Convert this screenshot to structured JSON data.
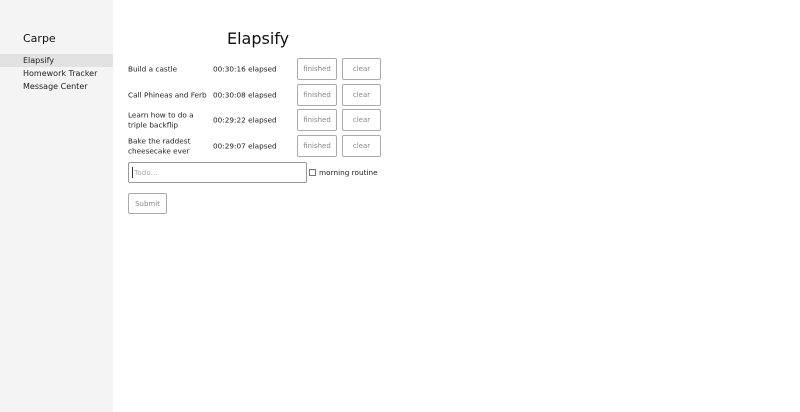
{
  "sidebar": {
    "brand": "Carpe",
    "items": [
      {
        "label": "Elapsify",
        "active": true
      },
      {
        "label": "Homework Tracker",
        "active": false
      },
      {
        "label": "Message Center",
        "active": false
      }
    ]
  },
  "main": {
    "title": "Elapsify",
    "tasks": [
      {
        "name": "Build a castle",
        "elapsed": "00:30:16 elapsed",
        "finish_label": "finished",
        "clear_label": "clear"
      },
      {
        "name": "Call Phineas and Ferb",
        "elapsed": "00:30:08 elapsed",
        "finish_label": "finished",
        "clear_label": "clear"
      },
      {
        "name": "Learn how to do a triple backflip",
        "elapsed": "00:29:22 elapsed",
        "finish_label": "finished",
        "clear_label": "clear"
      },
      {
        "name": "Bake the raddest cheesecake ever",
        "elapsed": "00:29:07 elapsed",
        "finish_label": "finished",
        "clear_label": "clear"
      }
    ],
    "form": {
      "todo_value": "",
      "todo_placeholder": "Todo...",
      "checkbox_label": "morning routine",
      "checkbox_checked": false,
      "submit_label": "Submit"
    }
  }
}
